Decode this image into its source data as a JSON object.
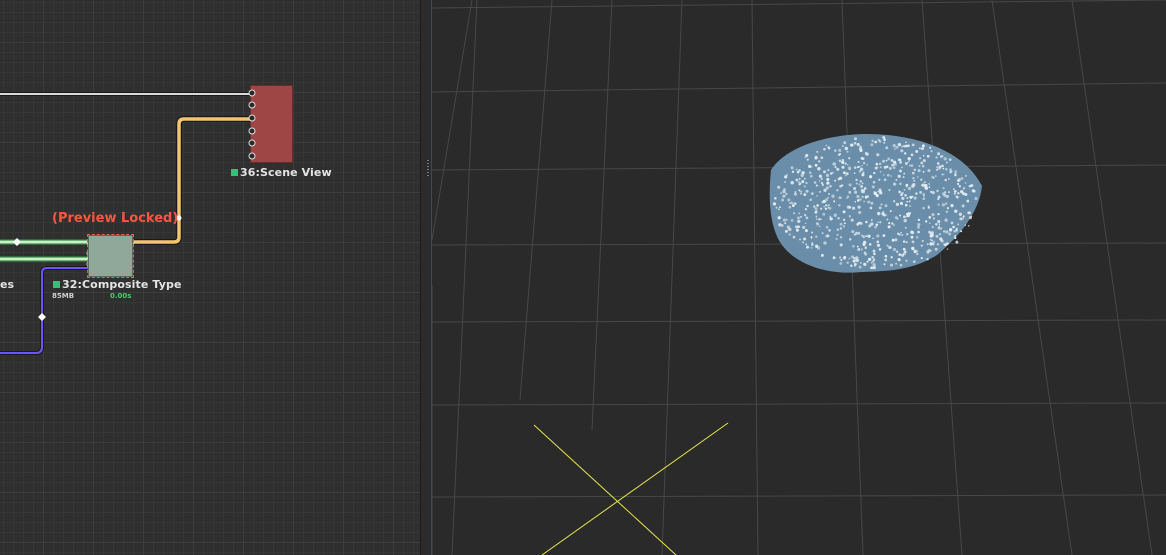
{
  "node_editor": {
    "preview_status": "(Preview Locked)",
    "partial_label": "es",
    "nodes": [
      {
        "id": "scene",
        "title": "36:Scene View",
        "color": "#9e4646",
        "flag_color": "#34c07a"
      },
      {
        "id": "composite",
        "title": "32:Composite Type",
        "memory": "85MB",
        "time": "0.00s",
        "color": "#8fa89a",
        "flag_color": "#34c07a"
      }
    ],
    "wire_colors": {
      "white": "#d8d8d8",
      "yellow": "#f2c66a",
      "green": "#b8efb6",
      "blue": "#6a55ff"
    }
  },
  "viewport": {
    "background": "#2a2a2a",
    "grid_color": "#4a4a4a",
    "point_cloud_color": "#6f93ae",
    "point_color": "#e6eef4",
    "axis_color": "#e4e44a"
  }
}
